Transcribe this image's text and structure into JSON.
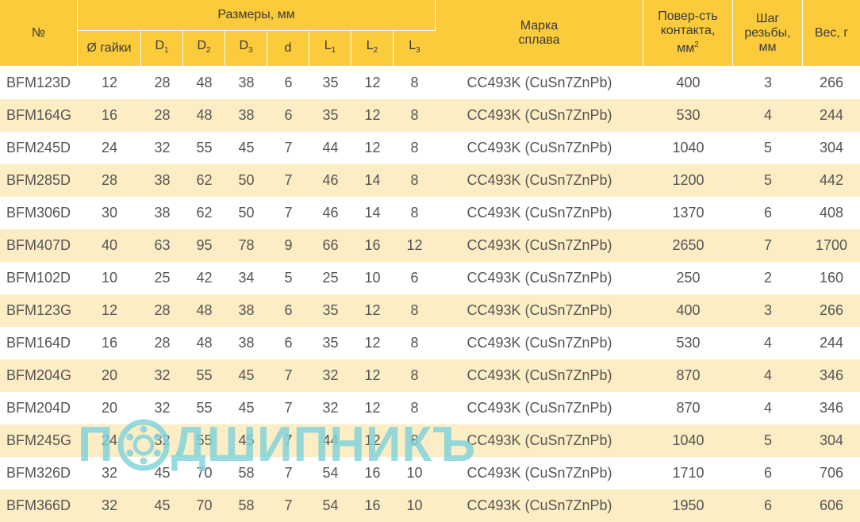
{
  "header": {
    "num": "№",
    "sizes_group": "Размеры, мм",
    "nut_diameter": "Ø гайки",
    "d1": "D",
    "d1_sub": "1",
    "d2": "D",
    "d2_sub": "2",
    "d3": "D",
    "d3_sub": "3",
    "d": "d",
    "l1": "L",
    "l1_sub": "1",
    "l2": "L",
    "l2_sub": "2",
    "l3": "L",
    "l3_sub": "3",
    "alloy_line1": "Марка",
    "alloy_line2": "сплава",
    "contact_line1": "Повер-сть",
    "contact_line2": "контакта,",
    "contact_line3": "мм",
    "contact_sup": "2",
    "pitch_line1": "Шаг",
    "pitch_line2": "резьбы,",
    "pitch_line3": "мм",
    "weight": "Вес, г"
  },
  "rows": [
    {
      "code": "BFM123D",
      "nut": "12",
      "d1": "28",
      "d2": "48",
      "d3": "38",
      "d": "6",
      "l1": "35",
      "l2": "12",
      "l3": "8",
      "alloy": "CC493K (CuSn7ZnPb)",
      "contact": "400",
      "pitch": "3",
      "weight": "266"
    },
    {
      "code": "BFM164G",
      "nut": "16",
      "d1": "28",
      "d2": "48",
      "d3": "38",
      "d": "6",
      "l1": "35",
      "l2": "12",
      "l3": "8",
      "alloy": "CC493K (CuSn7ZnPb)",
      "contact": "530",
      "pitch": "4",
      "weight": "244"
    },
    {
      "code": "BFM245D",
      "nut": "24",
      "d1": "32",
      "d2": "55",
      "d3": "45",
      "d": "7",
      "l1": "44",
      "l2": "12",
      "l3": "8",
      "alloy": "CC493K (CuSn7ZnPb)",
      "contact": "1040",
      "pitch": "5",
      "weight": "304"
    },
    {
      "code": "BFM285D",
      "nut": "28",
      "d1": "38",
      "d2": "62",
      "d3": "50",
      "d": "7",
      "l1": "46",
      "l2": "14",
      "l3": "8",
      "alloy": "CC493K (CuSn7ZnPb)",
      "contact": "1200",
      "pitch": "5",
      "weight": "442"
    },
    {
      "code": "BFM306D",
      "nut": "30",
      "d1": "38",
      "d2": "62",
      "d3": "50",
      "d": "7",
      "l1": "46",
      "l2": "14",
      "l3": "8",
      "alloy": "CC493K (CuSn7ZnPb)",
      "contact": "1370",
      "pitch": "6",
      "weight": "408"
    },
    {
      "code": "BFM407D",
      "nut": "40",
      "d1": "63",
      "d2": "95",
      "d3": "78",
      "d": "9",
      "l1": "66",
      "l2": "16",
      "l3": "12",
      "alloy": "CC493K (CuSn7ZnPb)",
      "contact": "2650",
      "pitch": "7",
      "weight": "1700"
    },
    {
      "code": "BFM102D",
      "nut": "10",
      "d1": "25",
      "d2": "42",
      "d3": "34",
      "d": "5",
      "l1": "25",
      "l2": "10",
      "l3": "6",
      "alloy": "CC493K (CuSn7ZnPb)",
      "contact": "250",
      "pitch": "2",
      "weight": "160"
    },
    {
      "code": "BFM123G",
      "nut": "12",
      "d1": "28",
      "d2": "48",
      "d3": "38",
      "d": "6",
      "l1": "35",
      "l2": "12",
      "l3": "8",
      "alloy": "CC493K (CuSn7ZnPb)",
      "contact": "400",
      "pitch": "3",
      "weight": "266"
    },
    {
      "code": "BFM164D",
      "nut": "16",
      "d1": "28",
      "d2": "48",
      "d3": "38",
      "d": "6",
      "l1": "35",
      "l2": "12",
      "l3": "8",
      "alloy": "CC493K (CuSn7ZnPb)",
      "contact": "530",
      "pitch": "4",
      "weight": "244"
    },
    {
      "code": "BFM204G",
      "nut": "20",
      "d1": "32",
      "d2": "55",
      "d3": "45",
      "d": "7",
      "l1": "32",
      "l2": "12",
      "l3": "8",
      "alloy": "CC493K (CuSn7ZnPb)",
      "contact": "870",
      "pitch": "4",
      "weight": "346"
    },
    {
      "code": "BFM204D",
      "nut": "20",
      "d1": "32",
      "d2": "55",
      "d3": "45",
      "d": "7",
      "l1": "32",
      "l2": "12",
      "l3": "8",
      "alloy": "CC493K (CuSn7ZnPb)",
      "contact": "870",
      "pitch": "4",
      "weight": "346"
    },
    {
      "code": "BFM245G",
      "nut": "24",
      "d1": "32",
      "d2": "55",
      "d3": "45",
      "d": "7",
      "l1": "44",
      "l2": "12",
      "l3": "8",
      "alloy": "CC493K (CuSn7ZnPb)",
      "contact": "1040",
      "pitch": "5",
      "weight": "304"
    },
    {
      "code": "BFM326D",
      "nut": "32",
      "d1": "45",
      "d2": "70",
      "d3": "58",
      "d": "7",
      "l1": "54",
      "l2": "16",
      "l3": "10",
      "alloy": "CC493K (CuSn7ZnPb)",
      "contact": "1710",
      "pitch": "6",
      "weight": "706"
    },
    {
      "code": "BFM366D",
      "nut": "32",
      "d1": "45",
      "d2": "70",
      "d3": "58",
      "d": "7",
      "l1": "54",
      "l2": "16",
      "l3": "10",
      "alloy": "CC493K (CuSn7ZnPb)",
      "contact": "1950",
      "pitch": "6",
      "weight": "606"
    }
  ],
  "watermark": {
    "prefix": "П",
    "suffix": "ДШИПНИКЪ",
    "icon": "bearing-icon",
    "color": "#7fd3dc"
  },
  "colors": {
    "header_bg": "#fbcb3b",
    "row_alt_bg": "#fdedc4",
    "row_plain_bg": "#ffffff"
  }
}
